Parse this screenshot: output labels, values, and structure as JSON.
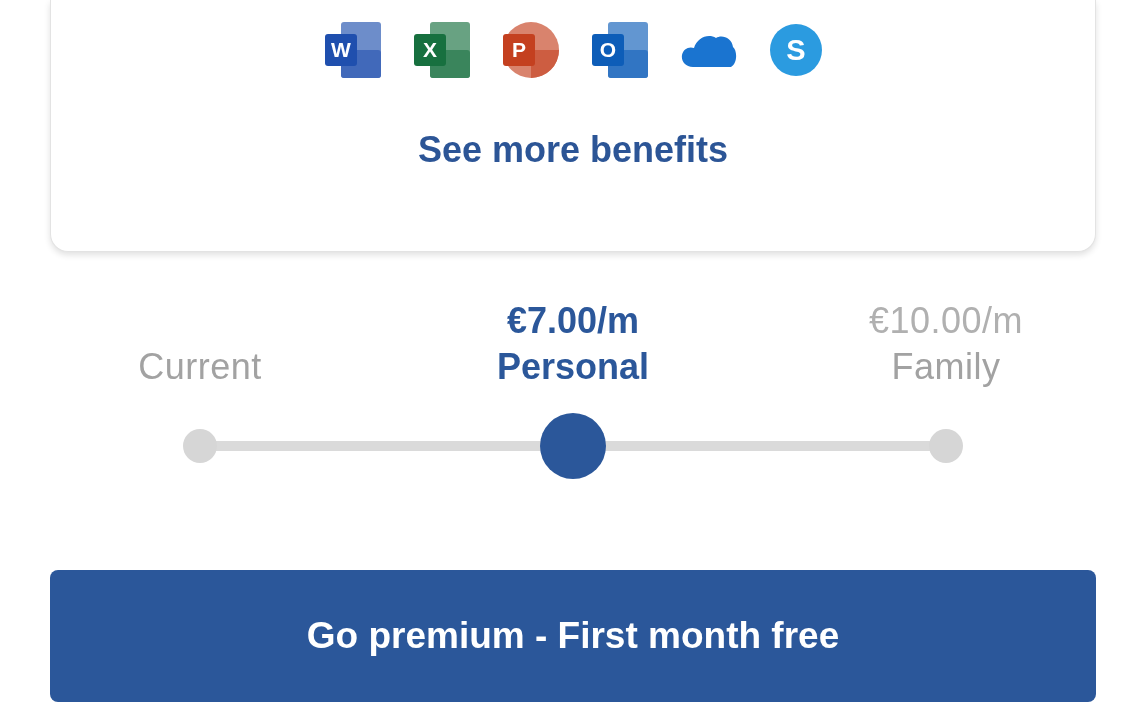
{
  "benefits_card": {
    "app_icons": [
      {
        "kind": "tile",
        "letter": "W",
        "color": "#1f4fae"
      },
      {
        "kind": "tile",
        "letter": "X",
        "color": "#17703f"
      },
      {
        "kind": "disc",
        "letter": "P",
        "color": "#c4401f"
      },
      {
        "kind": "tile",
        "letter": "O",
        "color": "#0d5db8"
      },
      {
        "kind": "cloud",
        "color": "#1a74d0"
      },
      {
        "kind": "circle",
        "letter": "S",
        "color": "#2b9be0"
      }
    ],
    "link": "See more benefits"
  },
  "plans": [
    {
      "name": "Current",
      "selected": false
    },
    {
      "price": "€7.00/m",
      "name": "Personal",
      "selected": true
    },
    {
      "price": "€10.00/m",
      "name": "Family",
      "selected": false
    }
  ],
  "plan_slider": {
    "level": 0.5
  },
  "primary_button": "Go premium - First month free"
}
